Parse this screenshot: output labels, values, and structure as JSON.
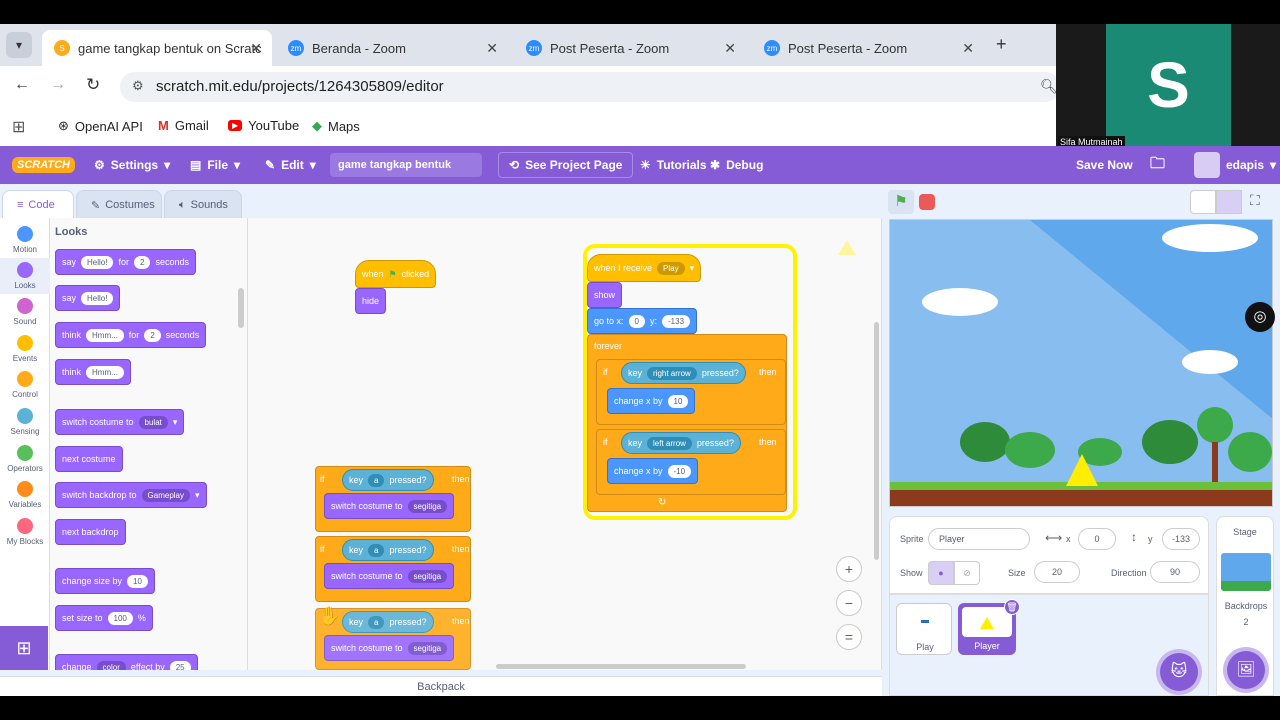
{
  "browser": {
    "tabs": [
      {
        "label": "game tangkap bentuk on Scratc"
      },
      {
        "label": "Beranda - Zoom"
      },
      {
        "label": "Post Peserta - Zoom"
      },
      {
        "label": "Post Peserta - Zoom"
      }
    ],
    "url": "scratch.mit.edu/projects/1264305809/editor",
    "bookmarks": [
      "OpenAI API",
      "Gmail",
      "YouTube",
      "Maps"
    ],
    "zoom_initial": "S",
    "zoom_name": "Sifa Mutmainah"
  },
  "menu": {
    "logo": "SCRATCH",
    "settings": "Settings",
    "file": "File",
    "edit": "Edit",
    "title": "game tangkap bentuk",
    "see_project": "See Project Page",
    "tutorials": "Tutorials",
    "debug": "Debug",
    "save": "Save Now",
    "user": "edapis"
  },
  "tabs": {
    "code": "Code",
    "costumes": "Costumes",
    "sounds": "Sounds"
  },
  "categories": [
    "Motion",
    "Looks",
    "Sound",
    "Events",
    "Control",
    "Sensing",
    "Operators",
    "Variables",
    "My Blocks"
  ],
  "category_colors": [
    "#4c97ff",
    "#9966ff",
    "#cf63cf",
    "#ffbf00",
    "#ffab19",
    "#5cb1d6",
    "#59c059",
    "#ff8c1a",
    "#ff6680"
  ],
  "palette": {
    "heading": "Looks",
    "say_for": {
      "a": "say",
      "b": "Hello!",
      "c": "for",
      "d": "2",
      "e": "seconds"
    },
    "say": {
      "a": "say",
      "b": "Hello!"
    },
    "think_for": {
      "a": "think",
      "b": "Hmm...",
      "c": "for",
      "d": "2",
      "e": "seconds"
    },
    "think": {
      "a": "think",
      "b": "Hmm..."
    },
    "switch_costume": {
      "a": "switch costume to",
      "b": "bulat"
    },
    "next_costume": "next costume",
    "switch_backdrop": {
      "a": "switch backdrop to",
      "b": "Gameplay"
    },
    "next_backdrop": "next backdrop",
    "change_size": {
      "a": "change size by",
      "b": "10"
    },
    "set_size": {
      "a": "set size to",
      "b": "100",
      "c": "%"
    },
    "change_effect": {
      "a": "change",
      "b": "color",
      "c": "effect by",
      "d": "25"
    }
  },
  "scripts": {
    "flag": {
      "when": "when",
      "clicked": "clicked",
      "hide": "hide"
    },
    "receive": {
      "when": "when I receive",
      "msg": "Play",
      "show": "show",
      "goto": "go to x:",
      "x": "0",
      "y_lbl": "y:",
      "y": "-133",
      "forever": "forever",
      "if": "if",
      "key": "key",
      "right": "right arrow",
      "pressed": "pressed?",
      "then": "then",
      "change_x": "change x by",
      "v1": "10",
      "left": "left arrow",
      "v2": "-10"
    },
    "ifblocks": [
      {
        "if": "if",
        "key": "key",
        "k": "a",
        "pressed": "pressed?",
        "then": "then",
        "sw": "switch costume to",
        "c": "segitiga"
      },
      {
        "if": "if",
        "key": "key",
        "k": "a",
        "pressed": "pressed?",
        "then": "then",
        "sw": "switch costume to",
        "c": "segitiga"
      },
      {
        "key": "key",
        "k": "a",
        "pressed": "pressed?",
        "then": "then",
        "sw": "switch costume to",
        "c": "segitiga"
      }
    ]
  },
  "backpack": "Backpack",
  "sprite": {
    "sprite_lbl": "Sprite",
    "name": "Player",
    "x_lbl": "x",
    "x": "0",
    "y_lbl": "y",
    "y": "-133",
    "show_lbl": "Show",
    "size_lbl": "Size",
    "size": "20",
    "dir_lbl": "Direction",
    "dir": "90"
  },
  "sprites": [
    {
      "name": "Play"
    },
    {
      "name": "Player"
    }
  ],
  "stage_panel": {
    "title": "Stage",
    "backdrops": "Backdrops",
    "count": "2"
  }
}
